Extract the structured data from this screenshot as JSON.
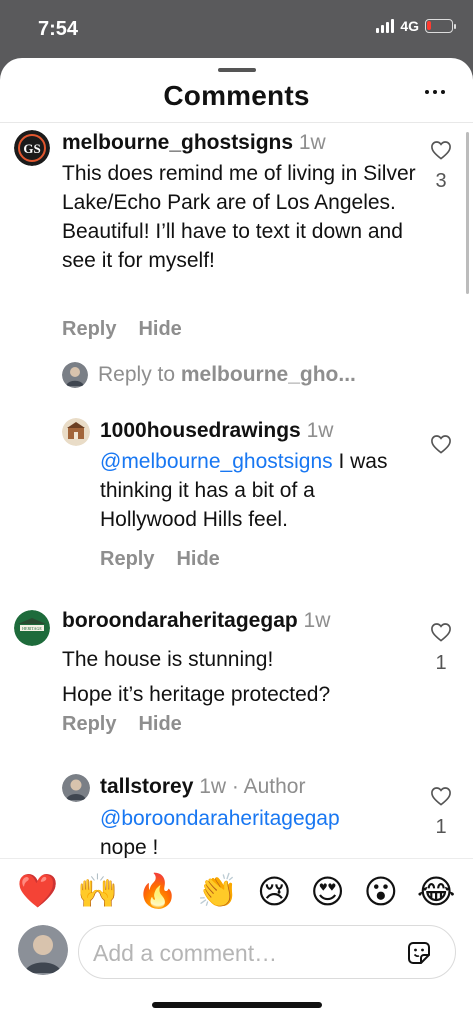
{
  "status_bar": {
    "time": "7:54",
    "network": "4G",
    "battery_level": 0.15
  },
  "sheet": {
    "title": "Comments"
  },
  "comments": [
    {
      "username": "melbourne_ghostsigns",
      "time": "1w",
      "text": "This does remind me of living in Silver Lake/Echo Park are of Los Angeles. Beautiful! I’ll have to text it down and see it for myself!",
      "likes": "3",
      "reply_label": "Reply",
      "hide_label": "Hide"
    },
    {
      "reply_to_prefix": "Reply to ",
      "reply_to_user": "melbourne_gho...",
      "username": "1000housedrawings",
      "time": "1w",
      "mention": "@melbourne_ghostsigns",
      "text": " I was thinking it has a bit of a Hollywood Hills feel.",
      "reply_label": "Reply",
      "hide_label": "Hide"
    },
    {
      "username": "boroondaraheritagegap",
      "time": "1w",
      "line1": "The house is stunning!",
      "line2": "Hope it’s heritage protected?",
      "likes": "1",
      "reply_label": "Reply",
      "hide_label": "Hide"
    },
    {
      "username": "tallstorey",
      "time": "1w · Author",
      "mention": "@boroondaraheritagegap",
      "text": "nope !",
      "likes": "1"
    }
  ],
  "emoji_bar": [
    "❤️",
    "🙌",
    "🔥",
    "👏",
    "😢",
    "😍",
    "😮",
    "😂"
  ],
  "composer": {
    "placeholder": "Add a comment…"
  },
  "colors": {
    "mention": "#1877f2",
    "muted": "#8e8e8e",
    "accent_heart": "#e8232d"
  }
}
